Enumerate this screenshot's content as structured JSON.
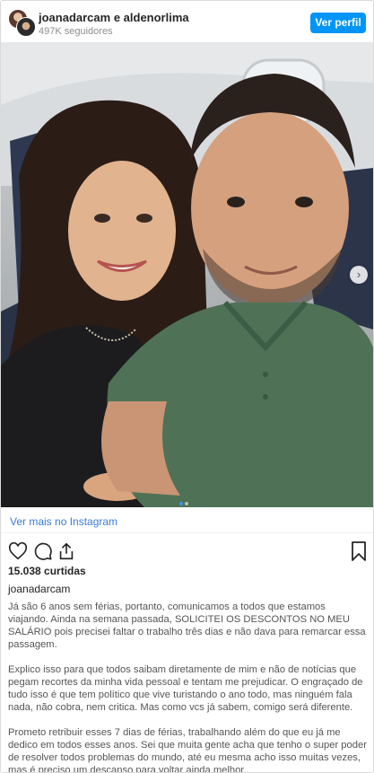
{
  "header": {
    "names": "joanadarcam e aldenorlima",
    "followers": "497K seguidores",
    "view_profile_label": "Ver perfil"
  },
  "photo": {
    "alt_icon": "carousel-next-icon",
    "dots_count": 2,
    "active_dot": 0
  },
  "view_more_label": "Ver mais no Instagram",
  "actions": {
    "icons": [
      "heart-icon",
      "comment-icon",
      "share-icon",
      "bookmark-icon"
    ]
  },
  "likes": "15.038 curtidas",
  "author": "joanadarcam",
  "caption": [
    "Já são 6 anos sem férias, portanto, comunicamos a todos que estamos viajando. Ainda na semana passada, SOLICITEI OS DESCONTOS NO MEU SALÁRIO pois precisei faltar o trabalho três dias e não dava para remarcar essa passagem.",
    "Explico isso para que todos saibam diretamente de mim e não de notícias que pegam recortes da minha vida pessoal e tentam me prejudicar. O engraçado de tudo isso é que tem político que vive turistando o ano todo, mas ninguém fala nada, não cobra, nem critica. Mas como vcs já sabem, comigo será diferente.",
    "Prometo retribuir esses 7 dias de férias, trabalhando além do que eu já me dedico em todos esses anos. Sei que muita gente acha que tenho o super poder de resolver todos problemas do mundo, até eu mesma acho isso muitas vezes, mas é preciso um descanso para voltar ainda melhor."
  ],
  "colors": {
    "primary_button": "#0095f6",
    "link": "#3a7bd5",
    "text": "#262626",
    "muted": "#8e8e8e"
  }
}
